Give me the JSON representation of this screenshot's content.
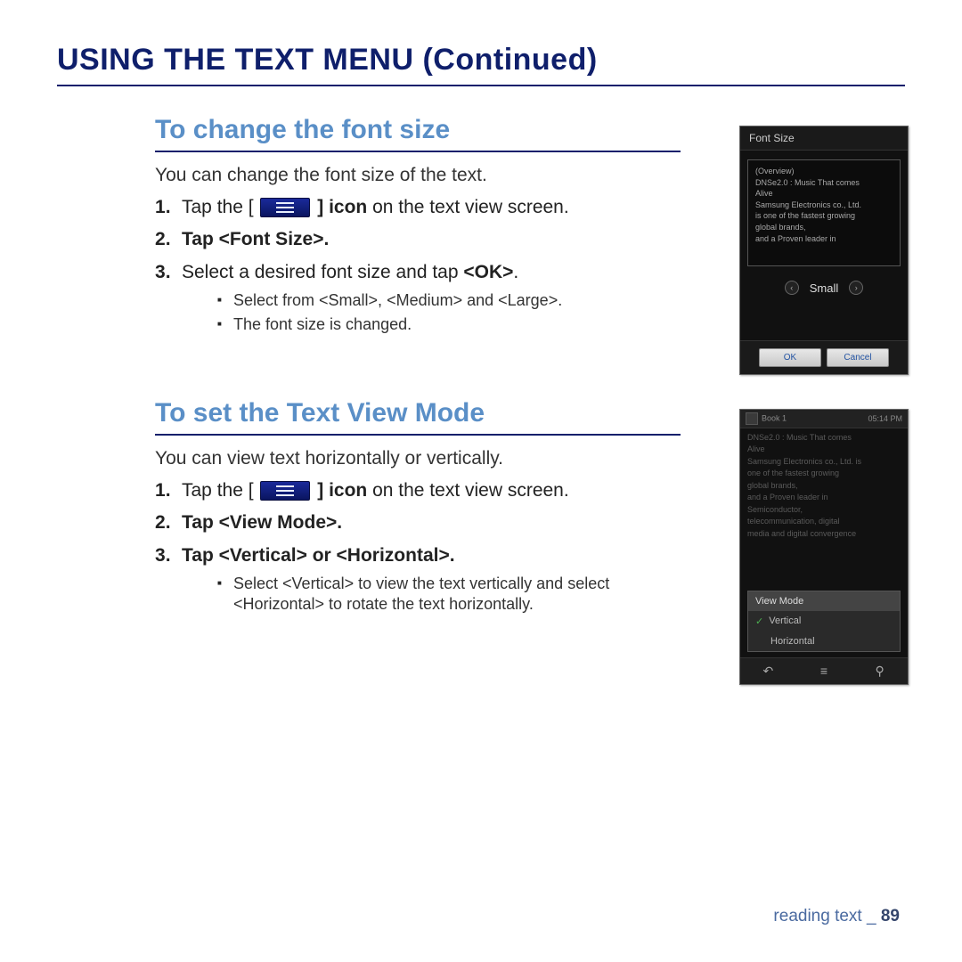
{
  "page_title": "USING THE TEXT MENU (Continued)",
  "section1": {
    "title": "To change the font size",
    "intro": "You can change the font size of the text.",
    "step1_pre": "Tap the [",
    "step1_post": " ] icon",
    "step1_tail": " on the text view screen.",
    "step2": "Tap <Font Size>.",
    "step3_pre": "Select a desired font size and tap ",
    "step3_ok": "<OK>",
    "step3_post": ".",
    "sub1": "Select from <Small>, <Medium> and <Large>.",
    "sub2": "The font size is changed."
  },
  "section2": {
    "title": "To set the Text View Mode",
    "intro": "You can view text horizontally or vertically.",
    "step1_pre": "Tap the [",
    "step1_post": " ] icon",
    "step1_tail": " on the text view screen.",
    "step2": "Tap <View Mode>.",
    "step3": "Tap <Vertical> or <Horizontal>.",
    "sub1": "Select <Vertical> to view the text vertically and select <Horizontal> to rotate the text horizontally."
  },
  "device_font": {
    "header": "Font Size",
    "preview": "(Overview)\nDNSe2.0 : Music That comes\nAlive\nSamsung Electronics co., Ltd.\nis one of the fastest growing\nglobal brands,\nand a Proven leader in",
    "selected": "Small",
    "ok": "OK",
    "cancel": "Cancel"
  },
  "device_view": {
    "statusbar_title": "Book 1",
    "statusbar_time": "05:14 PM",
    "body": "DNSe2.0 : Music That comes\nAlive\nSamsung Electronics co., Ltd. is\none of the fastest growing\nglobal brands,\nand a Proven leader in\nSemiconductor,\ntelecommunication, digital\nmedia and digital convergence",
    "popup_header": "View Mode",
    "opt_vertical": "Vertical",
    "opt_horizontal": "Horizontal"
  },
  "footer": {
    "chapter": "reading text",
    "sep": "_",
    "page": "89"
  }
}
